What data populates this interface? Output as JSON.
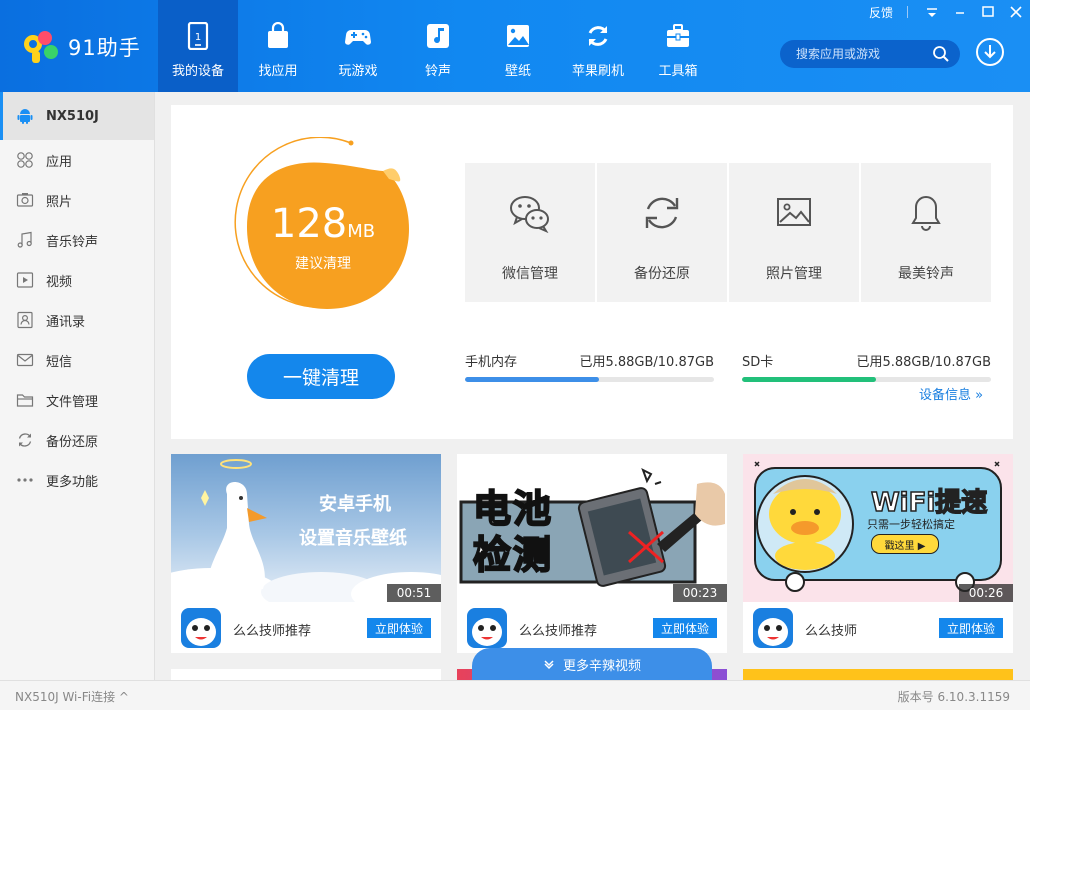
{
  "app": {
    "logo_text": "91助手"
  },
  "window": {
    "feedback": "反馈"
  },
  "nav": [
    {
      "label": "我的设备",
      "icon": "phone-icon",
      "active": true
    },
    {
      "label": "找应用",
      "icon": "shopping-bag-icon"
    },
    {
      "label": "玩游戏",
      "icon": "gamepad-icon"
    },
    {
      "label": "铃声",
      "icon": "music-note-icon"
    },
    {
      "label": "壁纸",
      "icon": "image-icon"
    },
    {
      "label": "苹果刷机",
      "icon": "refresh-icon"
    },
    {
      "label": "工具箱",
      "icon": "toolbox-icon"
    }
  ],
  "search": {
    "placeholder": "搜索应用或游戏"
  },
  "sidebar": {
    "device": "NX510J",
    "items": [
      {
        "label": "应用",
        "icon": "apps-grid-icon"
      },
      {
        "label": "照片",
        "icon": "camera-icon"
      },
      {
        "label": "音乐铃声",
        "icon": "music-icon"
      },
      {
        "label": "视频",
        "icon": "video-play-icon"
      },
      {
        "label": "通讯录",
        "icon": "contacts-icon"
      },
      {
        "label": "短信",
        "icon": "mail-icon"
      },
      {
        "label": "文件管理",
        "icon": "folder-icon"
      },
      {
        "label": "备份还原",
        "icon": "backup-icon"
      },
      {
        "label": "更多功能",
        "icon": "more-dots-icon"
      }
    ]
  },
  "cleanup": {
    "size": "128",
    "unit": "MB",
    "suggestion": "建议清理",
    "button": "一键清理"
  },
  "tools": [
    {
      "label": "微信管理",
      "icon": "wechat-icon"
    },
    {
      "label": "备份还原",
      "icon": "sync-icon"
    },
    {
      "label": "照片管理",
      "icon": "picture-icon"
    },
    {
      "label": "最美铃声",
      "icon": "bell-icon"
    }
  ],
  "storage": {
    "phone": {
      "label": "手机内存",
      "usage": "已用5.88GB/10.87GB",
      "fraction": 0.54,
      "color": "#3d8fe8"
    },
    "sd": {
      "label": "SD卡",
      "usage": "已用5.88GB/10.87GB",
      "fraction": 0.54,
      "color": "#22c07a"
    },
    "device_info": "设备信息 »"
  },
  "videos": [
    {
      "thumb_title_1": "安卓手机",
      "thumb_title_2": "设置音乐壁纸",
      "duration": "00:51",
      "author": "么么技师推荐",
      "button": "立即体验"
    },
    {
      "thumb_title_1": "电池",
      "thumb_title_2": "检测",
      "duration": "00:23",
      "author": "么么技师推荐",
      "button": "立即体验"
    },
    {
      "thumb_title_1": "WiFi提速",
      "thumb_title_2": "只需一步轻松搞定",
      "thumb_badge": "戳这里 ▶",
      "duration": "00:26",
      "author": "么么技师",
      "button": "立即体验"
    }
  ],
  "more_videos": "更多辛辣视频",
  "status": {
    "left": "NX510J  Wi-Fi连接 ^",
    "right": "版本号 6.10.3.1159"
  }
}
